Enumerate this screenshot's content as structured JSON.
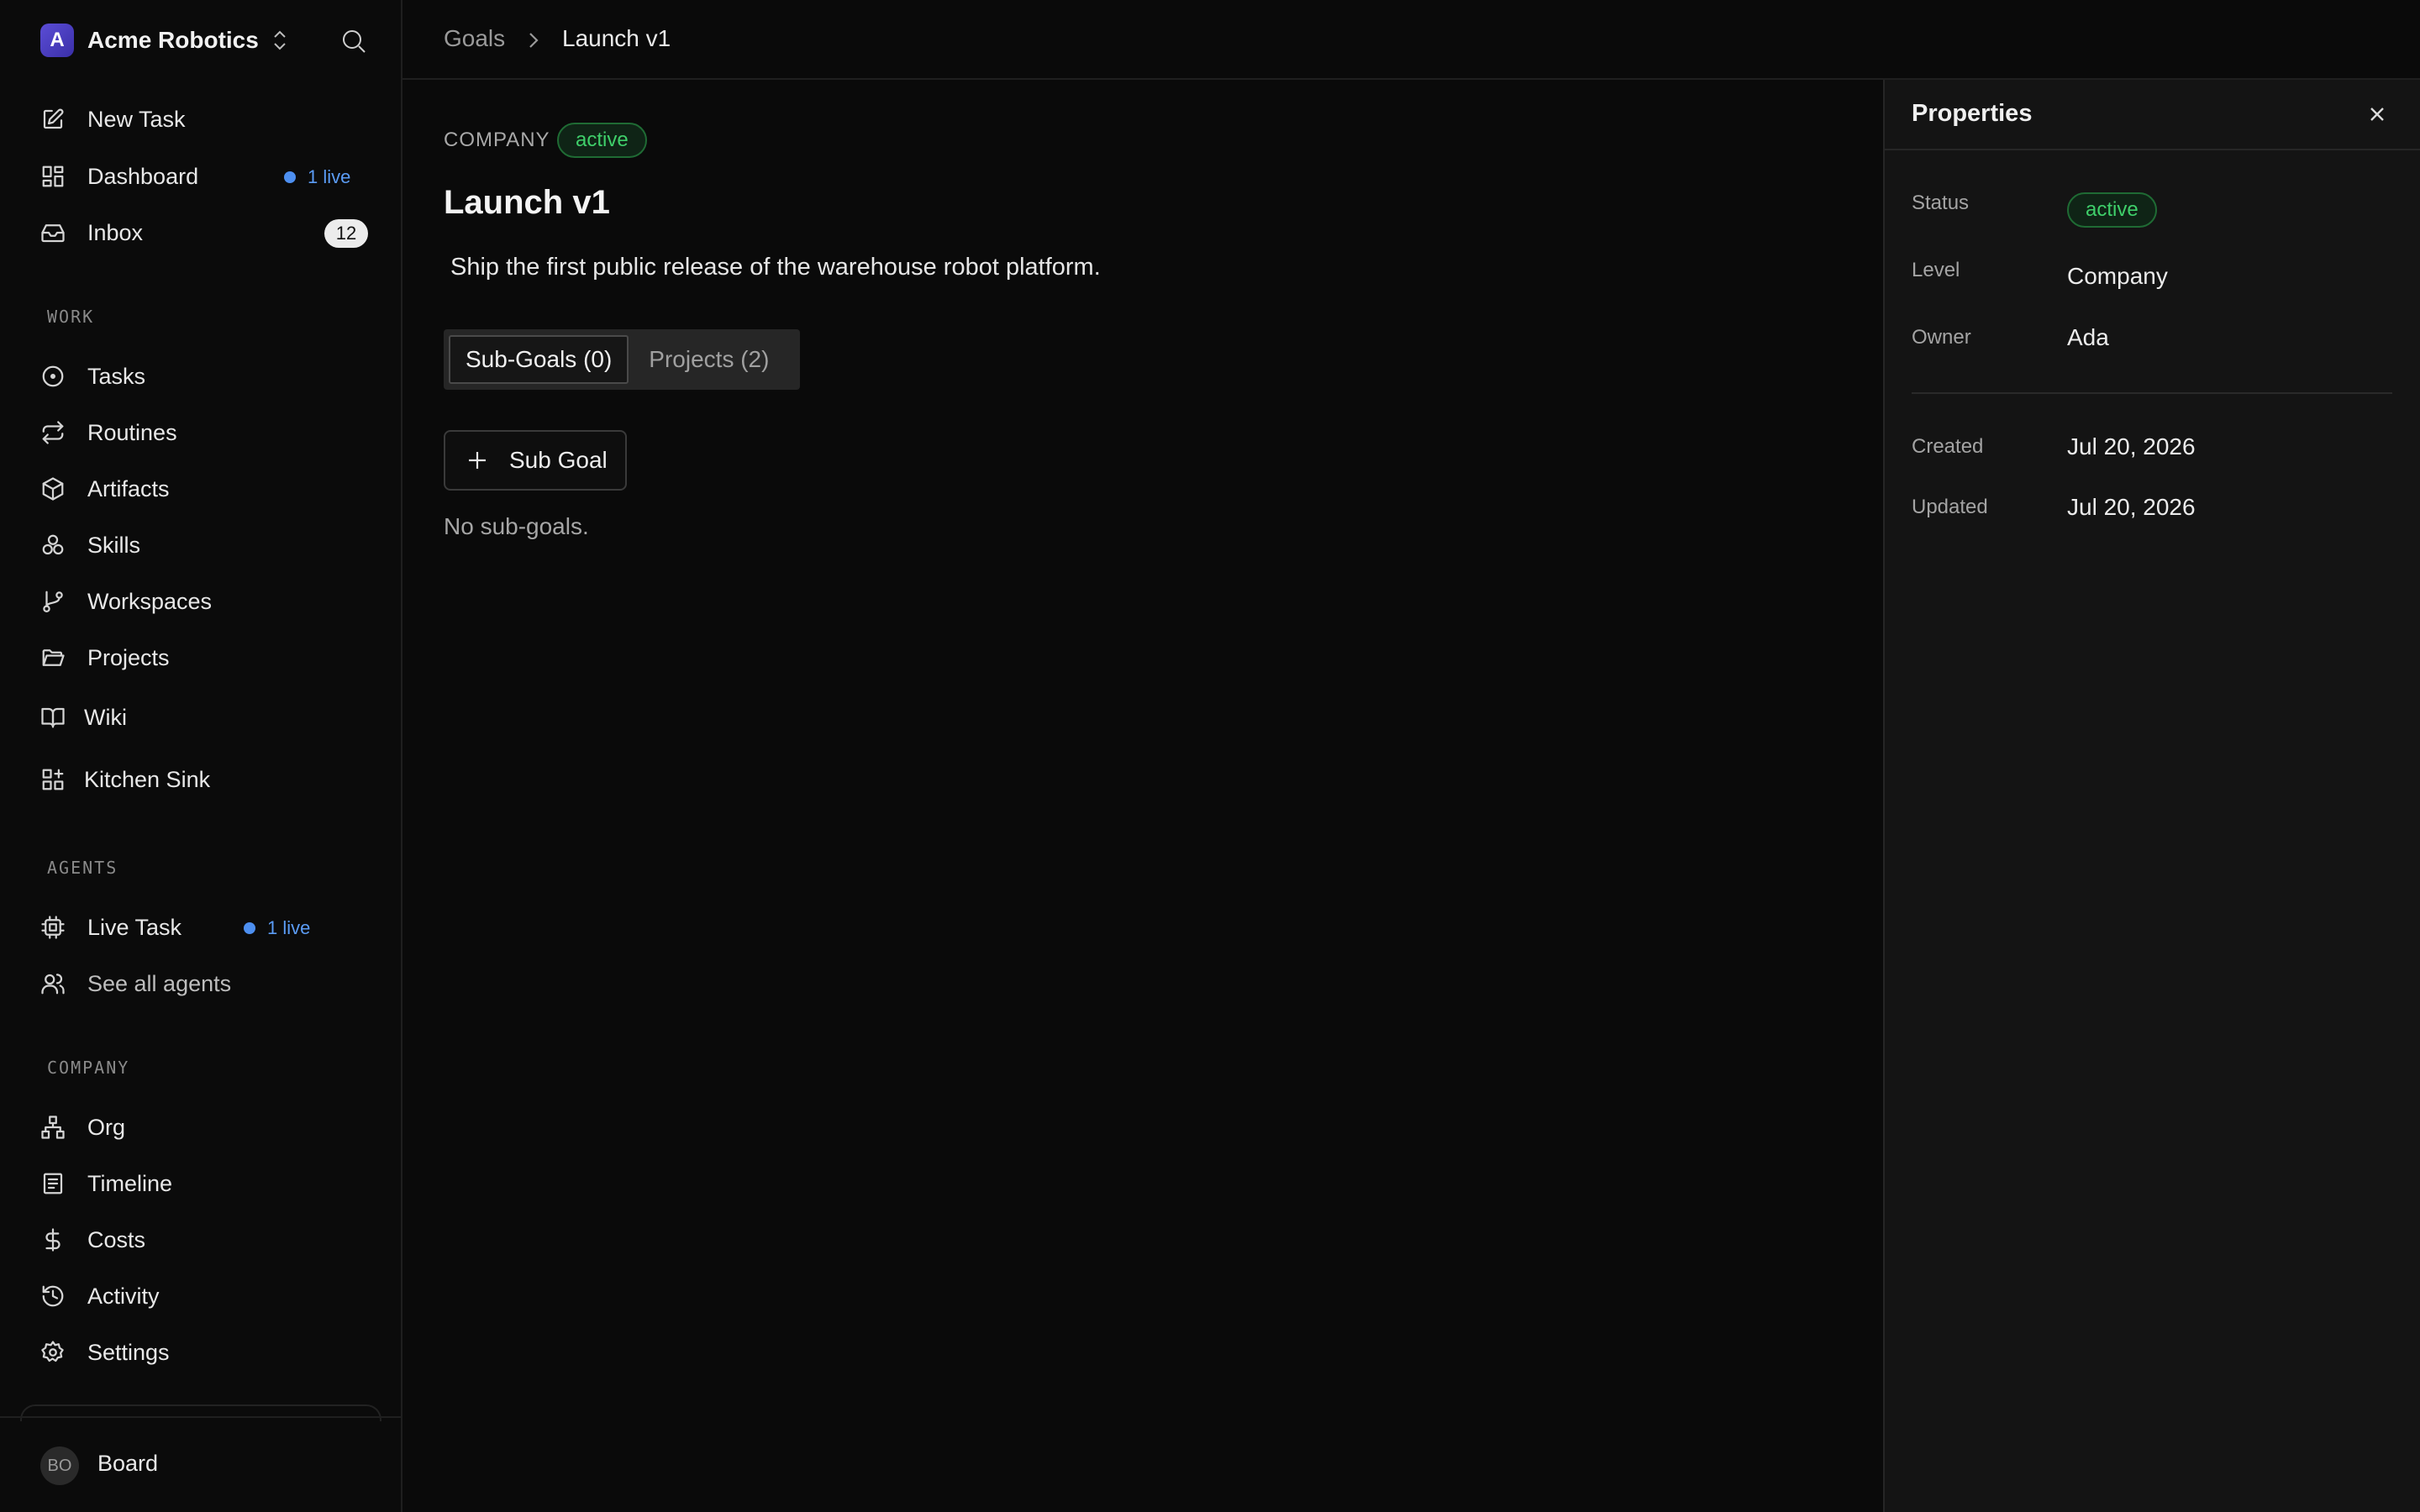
{
  "sidebar": {
    "brand": {
      "logo_letter": "A",
      "name": "Acme Robotics"
    },
    "top_items": [
      {
        "label": "New Task",
        "icon": "edit-icon"
      },
      {
        "label": "Dashboard",
        "icon": "dashboard-icon",
        "live": "1 live"
      },
      {
        "label": "Inbox",
        "icon": "inbox-icon",
        "count": "12"
      }
    ],
    "sections": {
      "work": "WORK",
      "agents": "AGENTS",
      "company": "COMPANY"
    },
    "work_items": [
      {
        "label": "Tasks",
        "icon": "circle-dot-icon"
      },
      {
        "label": "Routines",
        "icon": "repeat-icon"
      },
      {
        "label": "Artifacts",
        "icon": "package-icon"
      },
      {
        "label": "Skills",
        "icon": "skills-icon"
      },
      {
        "label": "Workspaces",
        "icon": "branch-icon"
      },
      {
        "label": "Projects",
        "icon": "folder-icon"
      },
      {
        "label": "Wiki",
        "icon": "book-icon"
      },
      {
        "label": "Kitchen Sink",
        "icon": "grid-plus-icon"
      }
    ],
    "agent_items": [
      {
        "label": "Live Task",
        "icon": "cpu-icon",
        "live": "1 live"
      },
      {
        "label": "See all agents",
        "icon": "users-icon"
      }
    ],
    "company_items": [
      {
        "label": "Org",
        "icon": "org-chart-icon"
      },
      {
        "label": "Timeline",
        "icon": "timeline-icon"
      },
      {
        "label": "Costs",
        "icon": "dollar-icon"
      },
      {
        "label": "Activity",
        "icon": "history-icon"
      },
      {
        "label": "Settings",
        "icon": "gear-icon"
      }
    ],
    "user": {
      "initials": "BO",
      "name": "Board"
    }
  },
  "breadcrumb": {
    "parent": "Goals",
    "current": "Launch v1"
  },
  "goal": {
    "level": "COMPANY",
    "status": "active",
    "title": "Launch v1",
    "description": "Ship the first public release of the warehouse robot platform.",
    "tabs": [
      {
        "label": "Sub-Goals (0)",
        "active": true
      },
      {
        "label": "Projects (2)",
        "active": false
      }
    ],
    "add_button": "Sub Goal",
    "empty_text": "No sub-goals."
  },
  "properties": {
    "title": "Properties",
    "status_label": "Status",
    "status_value": "active",
    "level_label": "Level",
    "level_value": "Company",
    "owner_label": "Owner",
    "owner_value": "Ada",
    "created_label": "Created",
    "created_value": "Jul 20, 2026",
    "updated_label": "Updated",
    "updated_value": "Jul 20, 2026"
  },
  "colors": {
    "background": "#0a0a0a",
    "panel": "#141414",
    "accent_live": "#4d8ff0",
    "status_active": "#3fcf6a"
  }
}
